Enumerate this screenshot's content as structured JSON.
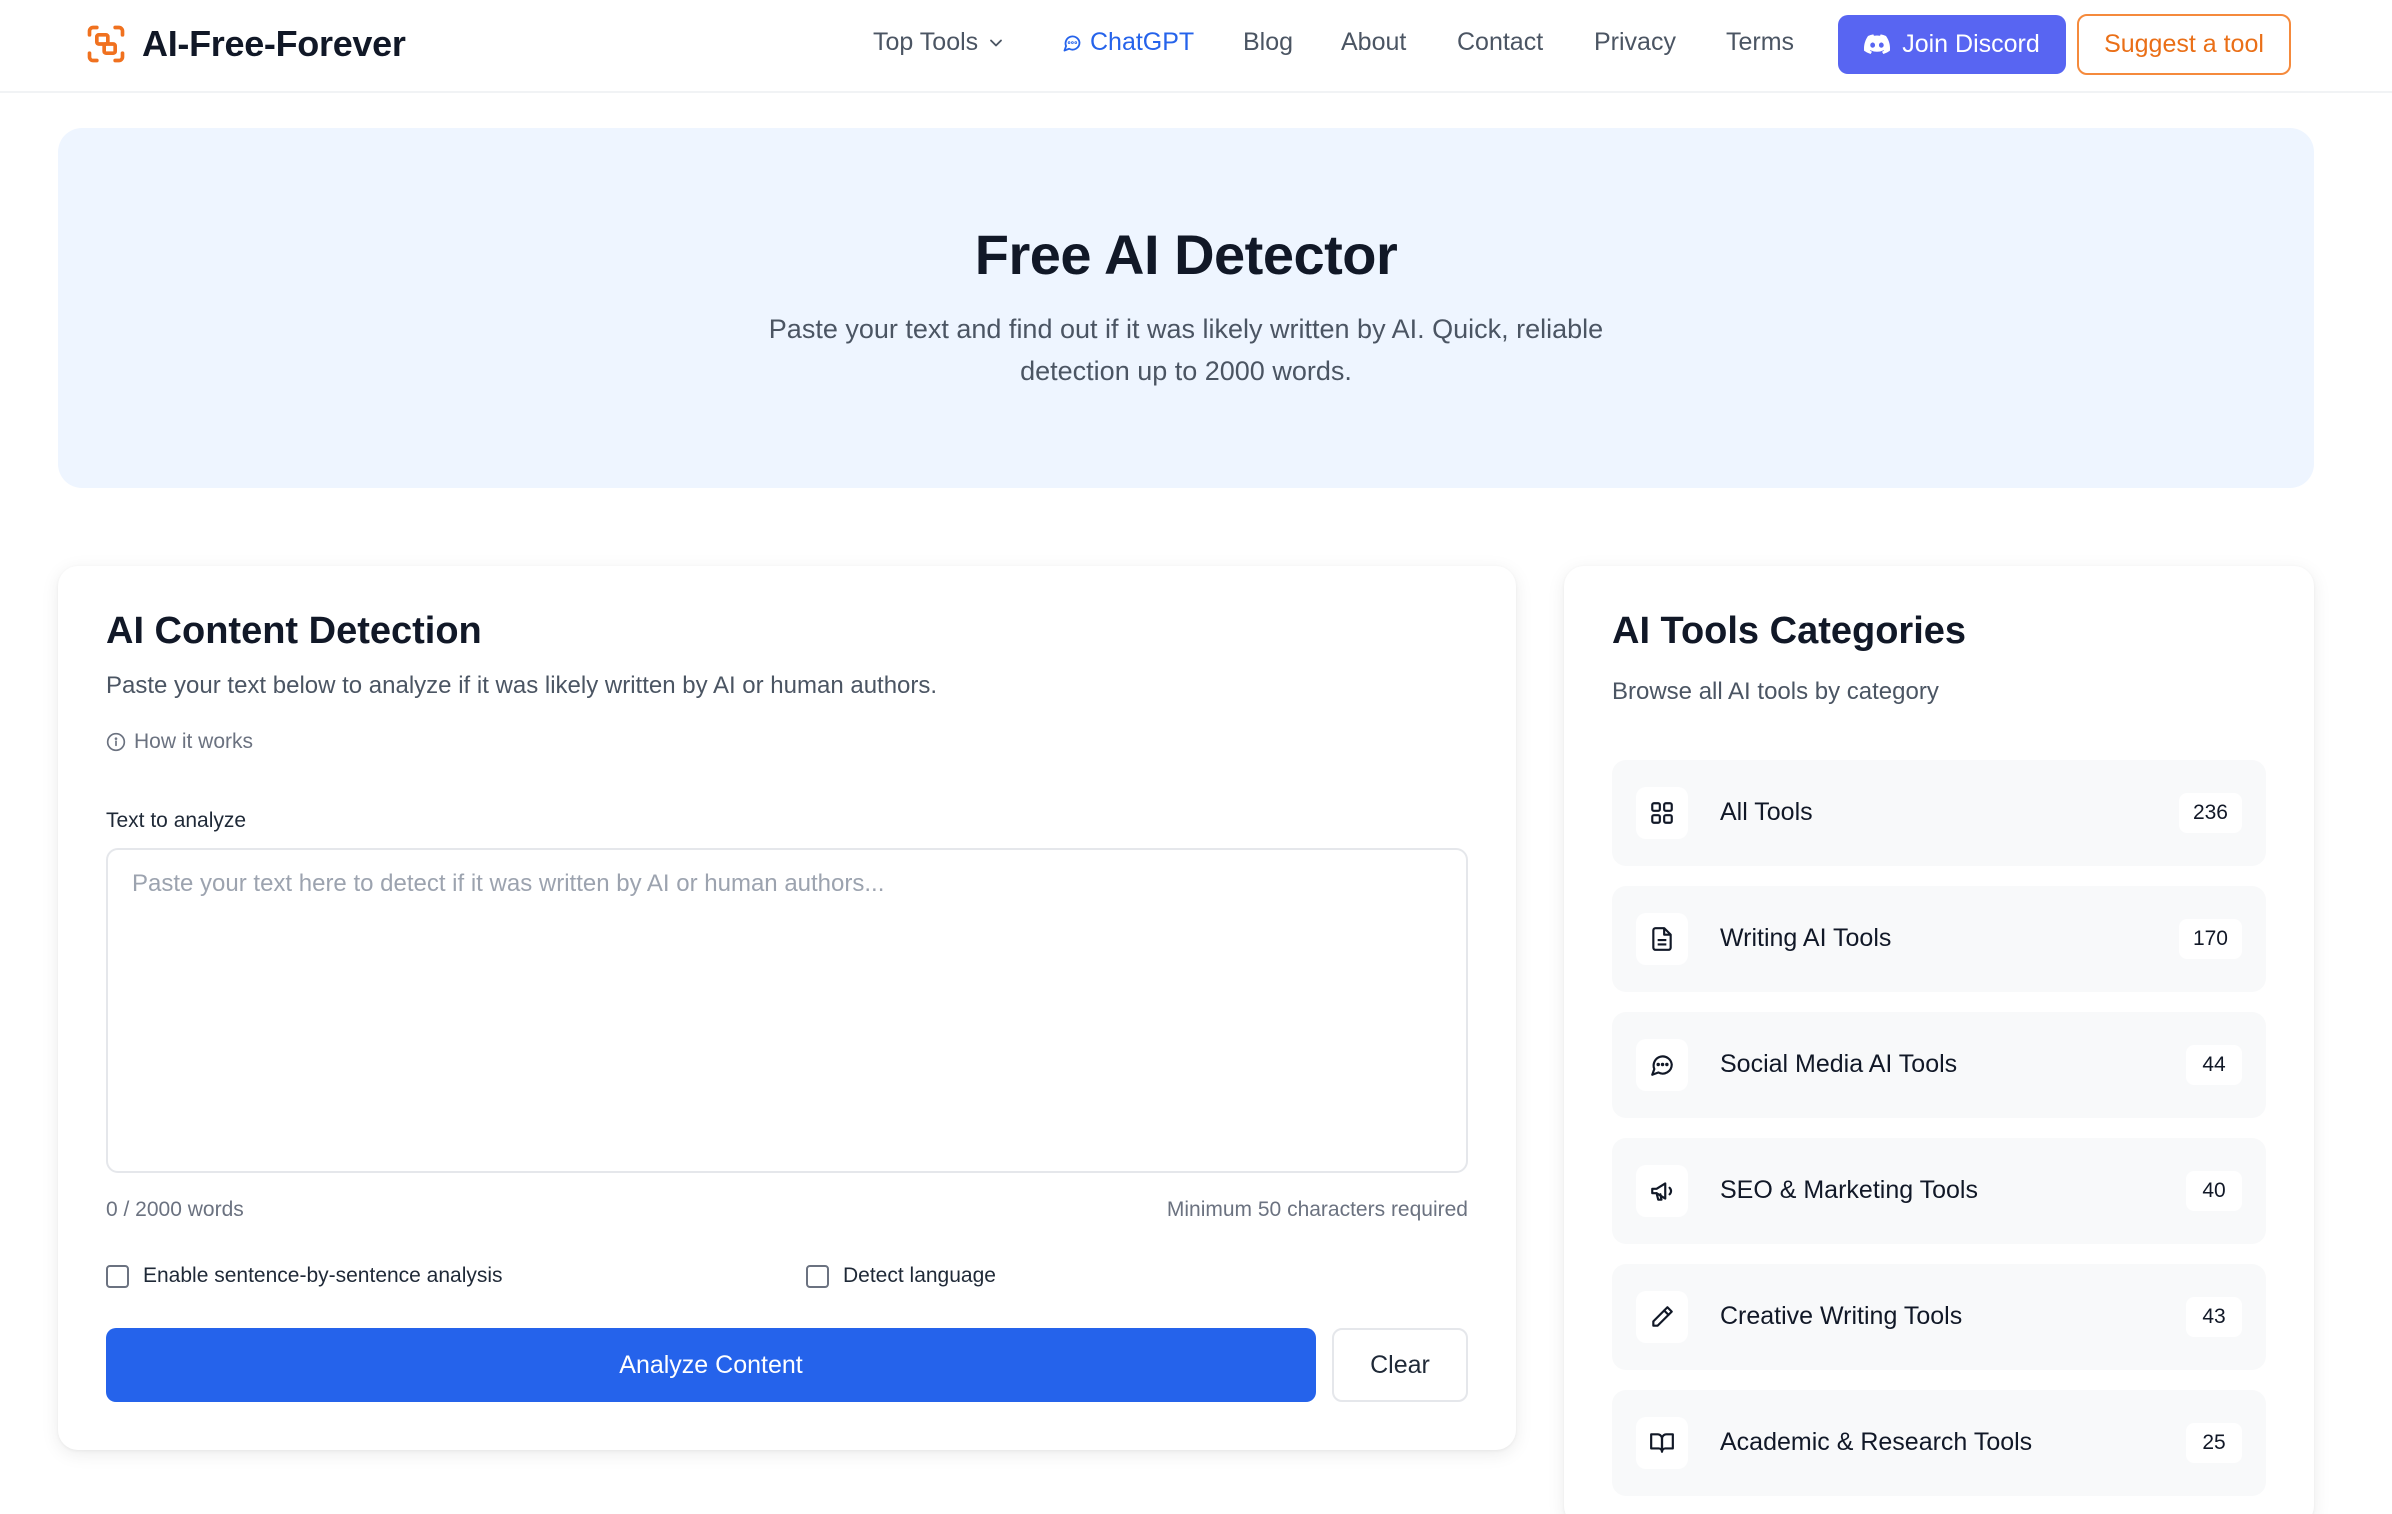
{
  "header": {
    "brand": "AI-Free-Forever",
    "nav": {
      "top_tools": "Top Tools",
      "chatgpt": "ChatGPT",
      "blog": "Blog",
      "about": "About",
      "contact": "Contact",
      "privacy": "Privacy",
      "terms": "Terms"
    },
    "join_discord": "Join Discord",
    "suggest_tool": "Suggest a tool"
  },
  "hero": {
    "title": "Free AI Detector",
    "subtitle": "Paste your text and find out if it was likely written by AI. Quick, reliable detection up to 2000 words."
  },
  "detector": {
    "title": "AI Content Detection",
    "subtitle": "Paste your text below to analyze if it was likely written by AI or human authors.",
    "how_it_works": "How it works",
    "field_label": "Text to analyze",
    "placeholder": "Paste your text here to detect if it was written by AI or human authors...",
    "value": "",
    "word_count": "0 / 2000 words",
    "min_required": "Minimum 50 characters required",
    "option_sentence": "Enable sentence-by-sentence analysis",
    "option_language": "Detect language",
    "analyze_button": "Analyze Content",
    "clear_button": "Clear"
  },
  "categories": {
    "title": "AI Tools Categories",
    "subtitle": "Browse all AI tools by category",
    "items": [
      {
        "label": "All Tools",
        "count": "236",
        "icon": "grid-icon"
      },
      {
        "label": "Writing AI Tools",
        "count": "170",
        "icon": "document-icon"
      },
      {
        "label": "Social Media AI Tools",
        "count": "44",
        "icon": "chat-bubble-icon"
      },
      {
        "label": "SEO & Marketing Tools",
        "count": "40",
        "icon": "megaphone-icon"
      },
      {
        "label": "Creative Writing Tools",
        "count": "43",
        "icon": "pencil-icon"
      },
      {
        "label": "Academic & Research Tools",
        "count": "25",
        "icon": "book-icon"
      }
    ]
  },
  "colors": {
    "primary": "#2563eb",
    "discord": "#5865f2",
    "accent_orange": "#f58a3c",
    "hero_bg": "#eef5ff"
  }
}
